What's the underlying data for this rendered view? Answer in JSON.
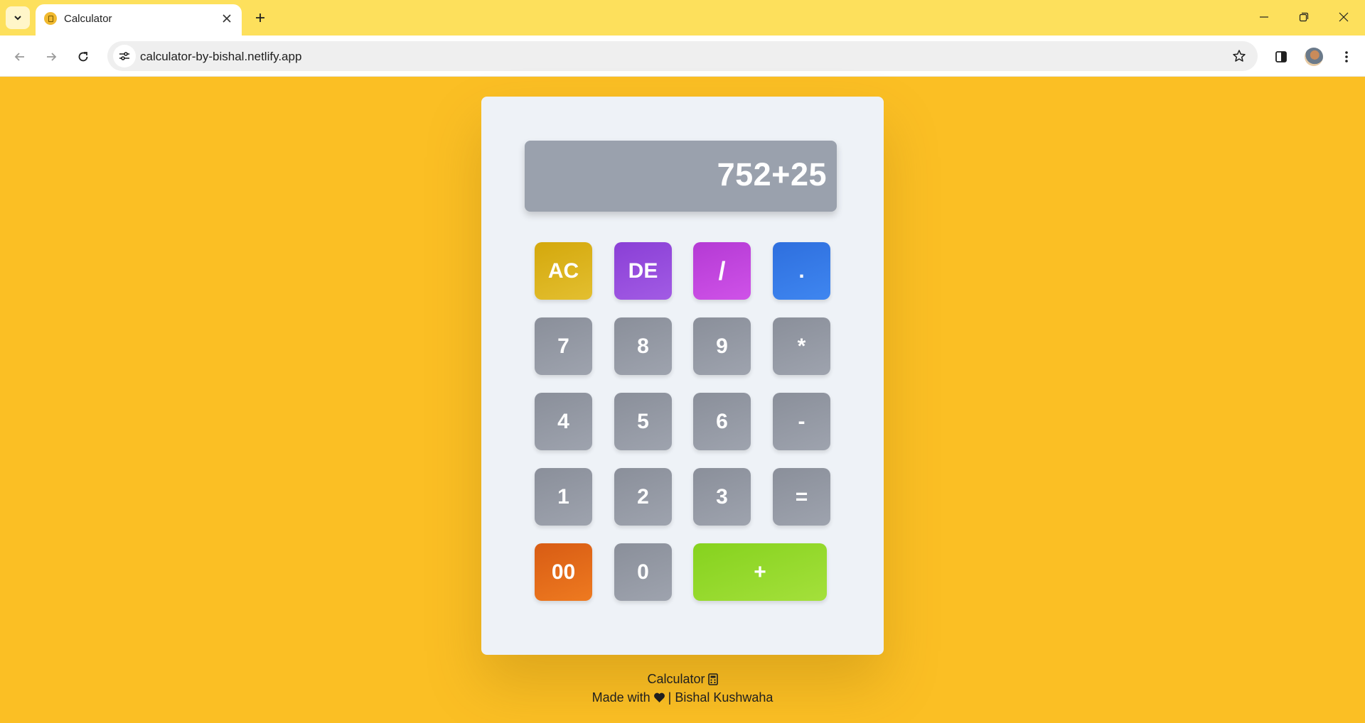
{
  "browser": {
    "tab_title": "Calculator",
    "url": "calculator-by-bishal.netlify.app"
  },
  "calculator": {
    "display": "752+25",
    "keys": {
      "ac": "AC",
      "de": "DE",
      "divide": "/",
      "dot": ".",
      "seven": "7",
      "eight": "8",
      "nine": "9",
      "multiply": "*",
      "four": "4",
      "five": "5",
      "six": "6",
      "minus": "-",
      "one": "1",
      "two": "2",
      "three": "3",
      "equals": "=",
      "double_zero": "00",
      "zero": "0",
      "plus": "+"
    },
    "colors": {
      "page_bg": "#fbbf24",
      "card_bg": "#eef2f7",
      "display_bg": "#9aa1ad",
      "ac": "#d4a80c",
      "de": "#8a3fd6",
      "divide": "#b43ad4",
      "dot": "#2e6fde",
      "double_zero": "#d85c14",
      "plus": "#86d21e",
      "digit": "#8a8f9a"
    }
  },
  "footer": {
    "title": "Calculator",
    "made_with": "Made with",
    "author": "| Bishal Kushwaha"
  },
  "icons": [
    "tab-list-icon",
    "favicon-icon",
    "close-icon",
    "plus-icon",
    "minimize-icon",
    "restore-icon",
    "window-close-icon",
    "back-icon",
    "forward-icon",
    "reload-icon",
    "site-info-icon",
    "star-icon",
    "side-panel-icon",
    "menu-icon",
    "calculator-icon",
    "heart-icon"
  ]
}
